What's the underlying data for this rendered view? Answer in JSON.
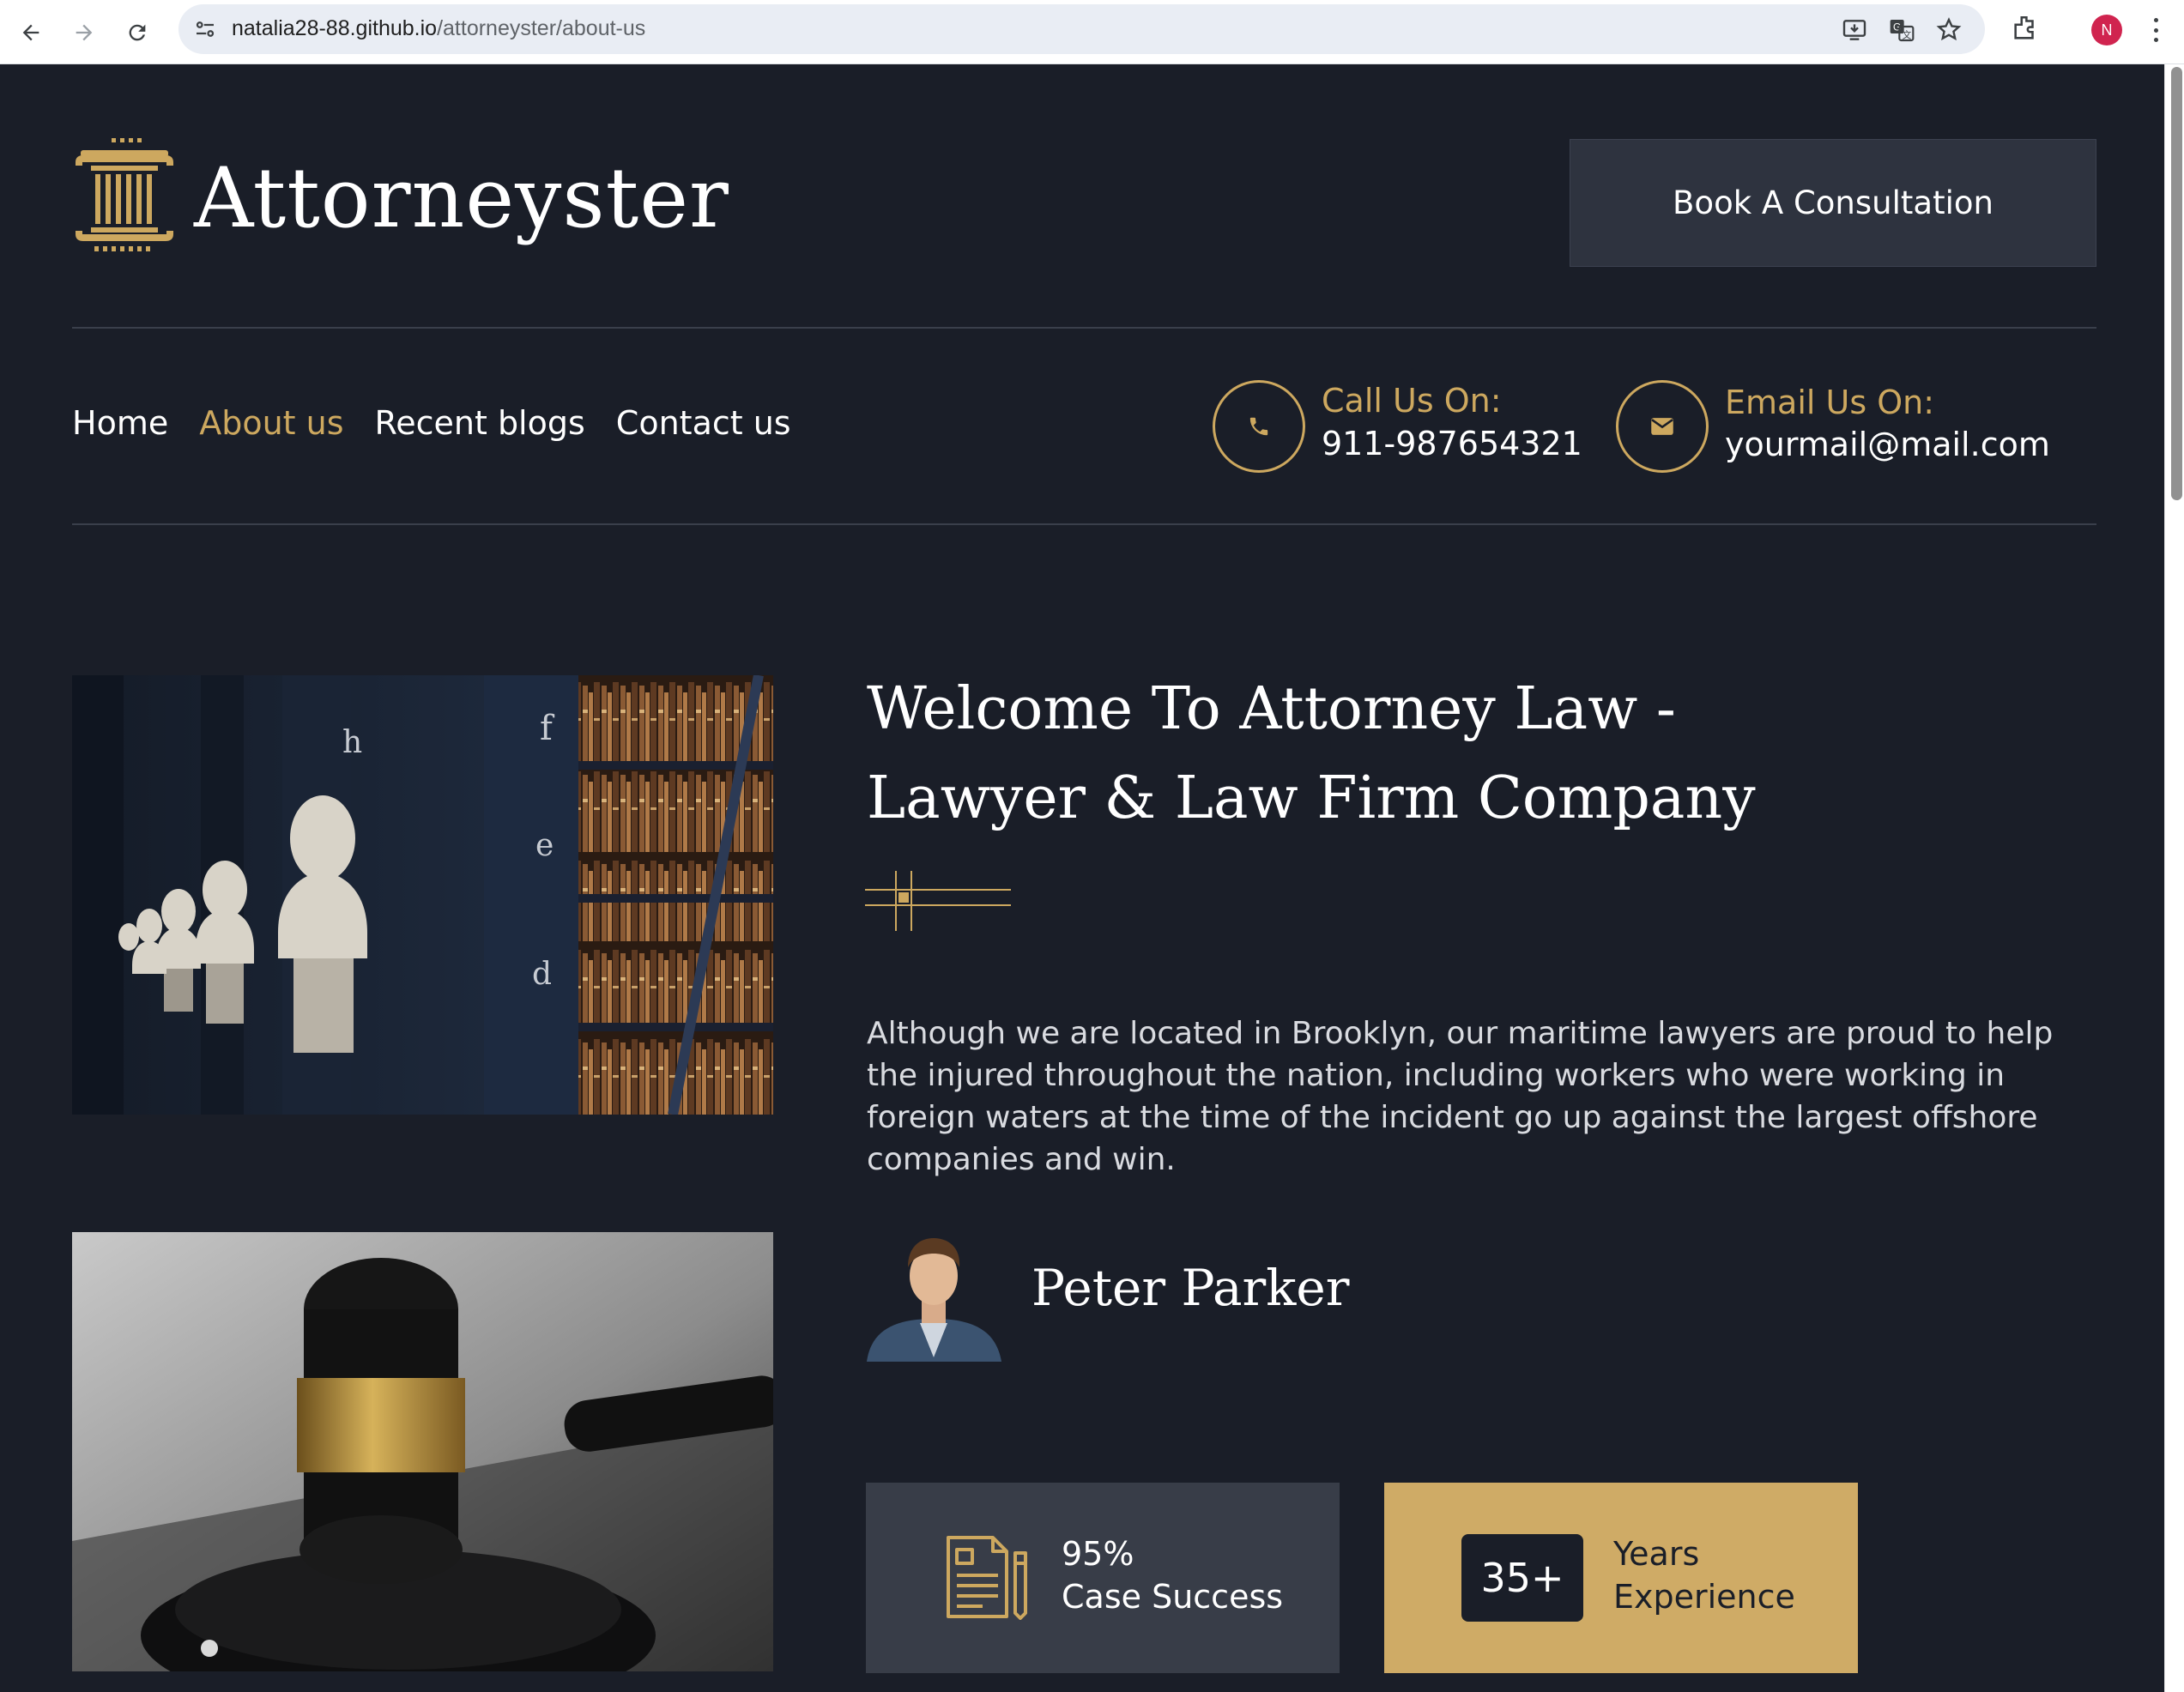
{
  "browser": {
    "url_host": "natalia28-88.github.io",
    "url_path": "/attorneyster/about-us",
    "profile_initial": "N"
  },
  "header": {
    "brand": "Attorneyster",
    "cta_label": "Book A Consultation"
  },
  "nav": {
    "items": [
      {
        "label": "Home",
        "active": false
      },
      {
        "label": "About us",
        "active": true
      },
      {
        "label": "Recent blogs",
        "active": false
      },
      {
        "label": "Contact us",
        "active": false
      }
    ]
  },
  "contact": {
    "phone_label": "Call Us On:",
    "phone_value": "911-987654321",
    "email_label": "Email Us On:",
    "email_value": "yourmail@mail.com"
  },
  "about": {
    "heading_line1": "Welcome To Attorney Law -",
    "heading_line2": "Lawyer & Law Firm Company",
    "paragraph": "Although we are located in Brooklyn, our maritime lawyers are proud to help the injured throughout the nation, including workers who were working in foreign waters at the time of the incident go up against the largest offshore companies and win.",
    "author_name": "Peter Parker"
  },
  "stats": {
    "case_percent": "95%",
    "case_label": "Case Success",
    "years_value": "35+",
    "years_line1": "Years",
    "years_line2": "Experience"
  },
  "colors": {
    "background": "#1a1e28",
    "accent_gold": "#cda85f",
    "card_dark": "#383d48",
    "card_gold": "#cfab66"
  },
  "icons": [
    "back-arrow-icon",
    "forward-arrow-icon",
    "reload-icon",
    "site-info-icon",
    "install-app-icon",
    "translate-icon",
    "bookmark-star-icon",
    "extensions-icon",
    "menu-kebab-icon",
    "pillar-logo-icon",
    "phone-icon",
    "envelope-icon",
    "document-pencil-icon"
  ]
}
